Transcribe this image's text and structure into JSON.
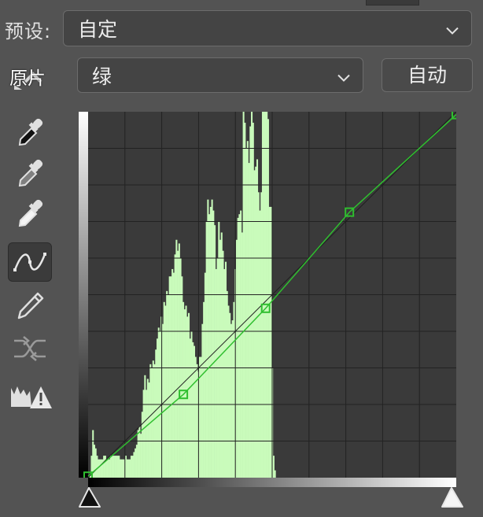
{
  "preset": {
    "label": "预设:",
    "value": "自定"
  },
  "channel": {
    "value": "绿",
    "auto_label": "自动"
  },
  "tools": [
    {
      "name": "on-image-adjust-icon",
      "label": "原片"
    },
    {
      "name": "black-point-eyedropper-icon"
    },
    {
      "name": "gray-point-eyedropper-icon"
    },
    {
      "name": "white-point-eyedropper-icon"
    },
    {
      "name": "curve-points-icon",
      "active": true
    },
    {
      "name": "pencil-icon"
    },
    {
      "name": "smooth-curve-icon"
    },
    {
      "name": "clipping-warning-icon"
    }
  ],
  "curve": {
    "channel_color": "#2fbf2f",
    "histogram_color": "#c9fbbb",
    "grid_divisions": 10,
    "input_range": [
      0,
      255
    ],
    "output_range": [
      0,
      255
    ],
    "points": [
      {
        "in": 0,
        "out": 1
      },
      {
        "in": 66,
        "out": 58
      },
      {
        "in": 123,
        "out": 118
      },
      {
        "in": 181,
        "out": 185
      },
      {
        "in": 255,
        "out": 253
      }
    ],
    "histogram": [
      0,
      1,
      6,
      13,
      9,
      8,
      6,
      5,
      5,
      5,
      5,
      6,
      6,
      5,
      5,
      5,
      6,
      6,
      6,
      6,
      6,
      6,
      6,
      5,
      5,
      5,
      5,
      6,
      5,
      5,
      5,
      6,
      6,
      7,
      8,
      9,
      13,
      14,
      12,
      18,
      24,
      28,
      24,
      27,
      26,
      31,
      30,
      32,
      31,
      35,
      38,
      41,
      40,
      44,
      42,
      48,
      47,
      51,
      50,
      55,
      55,
      57,
      56,
      61,
      65,
      62,
      64,
      60,
      55,
      48,
      46,
      47,
      44,
      45,
      38,
      40,
      37,
      36,
      33,
      31,
      29,
      33,
      33,
      42,
      48,
      56,
      70,
      76,
      72,
      74,
      76,
      73,
      69,
      57,
      60,
      70,
      65,
      67,
      62,
      57,
      59,
      51,
      47,
      45,
      42,
      43,
      48,
      57,
      65,
      71,
      72,
      73,
      67,
      100,
      97,
      90,
      92,
      86,
      96,
      101,
      97,
      84,
      85,
      87,
      78,
      73,
      78,
      100,
      100,
      100,
      100,
      98,
      74,
      74,
      30,
      6,
      2,
      0,
      0,
      0,
      0,
      0,
      0,
      0,
      0,
      0,
      0,
      0,
      0,
      0,
      0,
      0,
      0,
      0,
      0,
      0,
      0,
      0,
      0,
      0,
      0,
      0,
      0,
      0,
      0,
      0,
      0,
      0,
      0,
      0,
      0,
      0,
      0,
      0,
      0,
      0,
      0,
      0,
      0,
      0,
      0,
      0,
      0,
      0,
      0,
      0,
      0,
      0,
      0,
      0,
      0,
      0,
      0,
      0,
      0,
      0,
      0,
      0,
      0,
      0,
      0,
      0,
      0,
      0,
      0,
      0,
      0,
      0,
      0,
      0,
      0,
      0,
      0,
      0,
      0,
      0,
      0,
      0,
      0,
      0,
      0,
      0,
      0,
      0,
      0,
      0,
      0,
      0,
      0,
      0,
      0,
      0,
      0,
      0,
      0,
      0,
      0,
      0,
      0,
      0,
      0,
      0,
      0,
      0,
      0,
      0,
      0,
      0,
      0,
      0,
      0,
      0,
      0,
      0,
      0,
      0,
      0,
      0,
      0,
      0,
      0,
      0,
      0,
      0,
      0,
      0,
      0,
      0,
      0
    ]
  }
}
